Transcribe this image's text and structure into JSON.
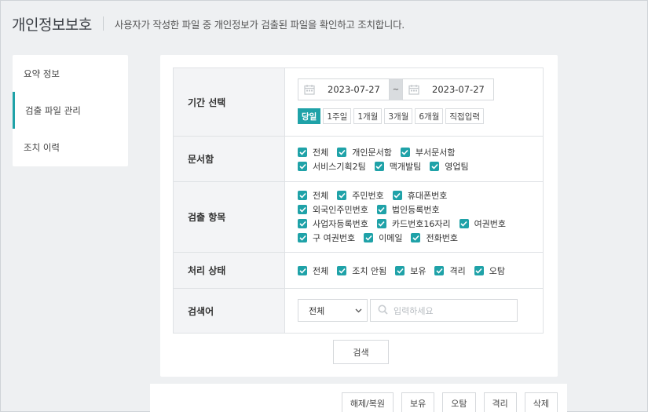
{
  "header": {
    "title": "개인정보보호",
    "description": "사용자가 작성한 파일 중 개인정보가 검출된 파일을 확인하고 조치합니다."
  },
  "sidebar": {
    "items": [
      {
        "label": "요약 정보",
        "active": false
      },
      {
        "label": "검출 파일 관리",
        "active": true
      },
      {
        "label": "조치 이력",
        "active": false
      }
    ]
  },
  "filter": {
    "period": {
      "label": "기간 선택",
      "start": "2023-07-27",
      "separator": "~",
      "end": "2023-07-27",
      "buttons": [
        "당일",
        "1주일",
        "1개월",
        "3개월",
        "6개월",
        "직접입력"
      ],
      "selected": "당일"
    },
    "docbox": {
      "label": "문서함",
      "lines": [
        [
          "전체",
          "개인문서함",
          "부서문서함"
        ],
        [
          "서비스기획2팀",
          "맥개발팀",
          "영업팀"
        ]
      ]
    },
    "detect": {
      "label": "검출 항목",
      "lines": [
        [
          "전체",
          "주민번호",
          "휴대폰번호"
        ],
        [
          "외국인주민번호",
          "법인등록번호"
        ],
        [
          "사업자등록번호",
          "카드번호16자리",
          "여권번호"
        ],
        [
          "구 여권번호",
          "이메일",
          "전화번호"
        ]
      ]
    },
    "status": {
      "label": "처리 상태",
      "lines": [
        [
          "전체",
          "조치 안됨",
          "보유",
          "격리",
          "오탐"
        ]
      ]
    },
    "keyword": {
      "label": "검색어",
      "select_value": "전체",
      "placeholder": "입력하세요"
    }
  },
  "search_button": "검색",
  "actions": [
    "해제/복원",
    "보유",
    "오탐",
    "격리",
    "삭제"
  ],
  "colors": {
    "accent": "#1fa2a8"
  }
}
